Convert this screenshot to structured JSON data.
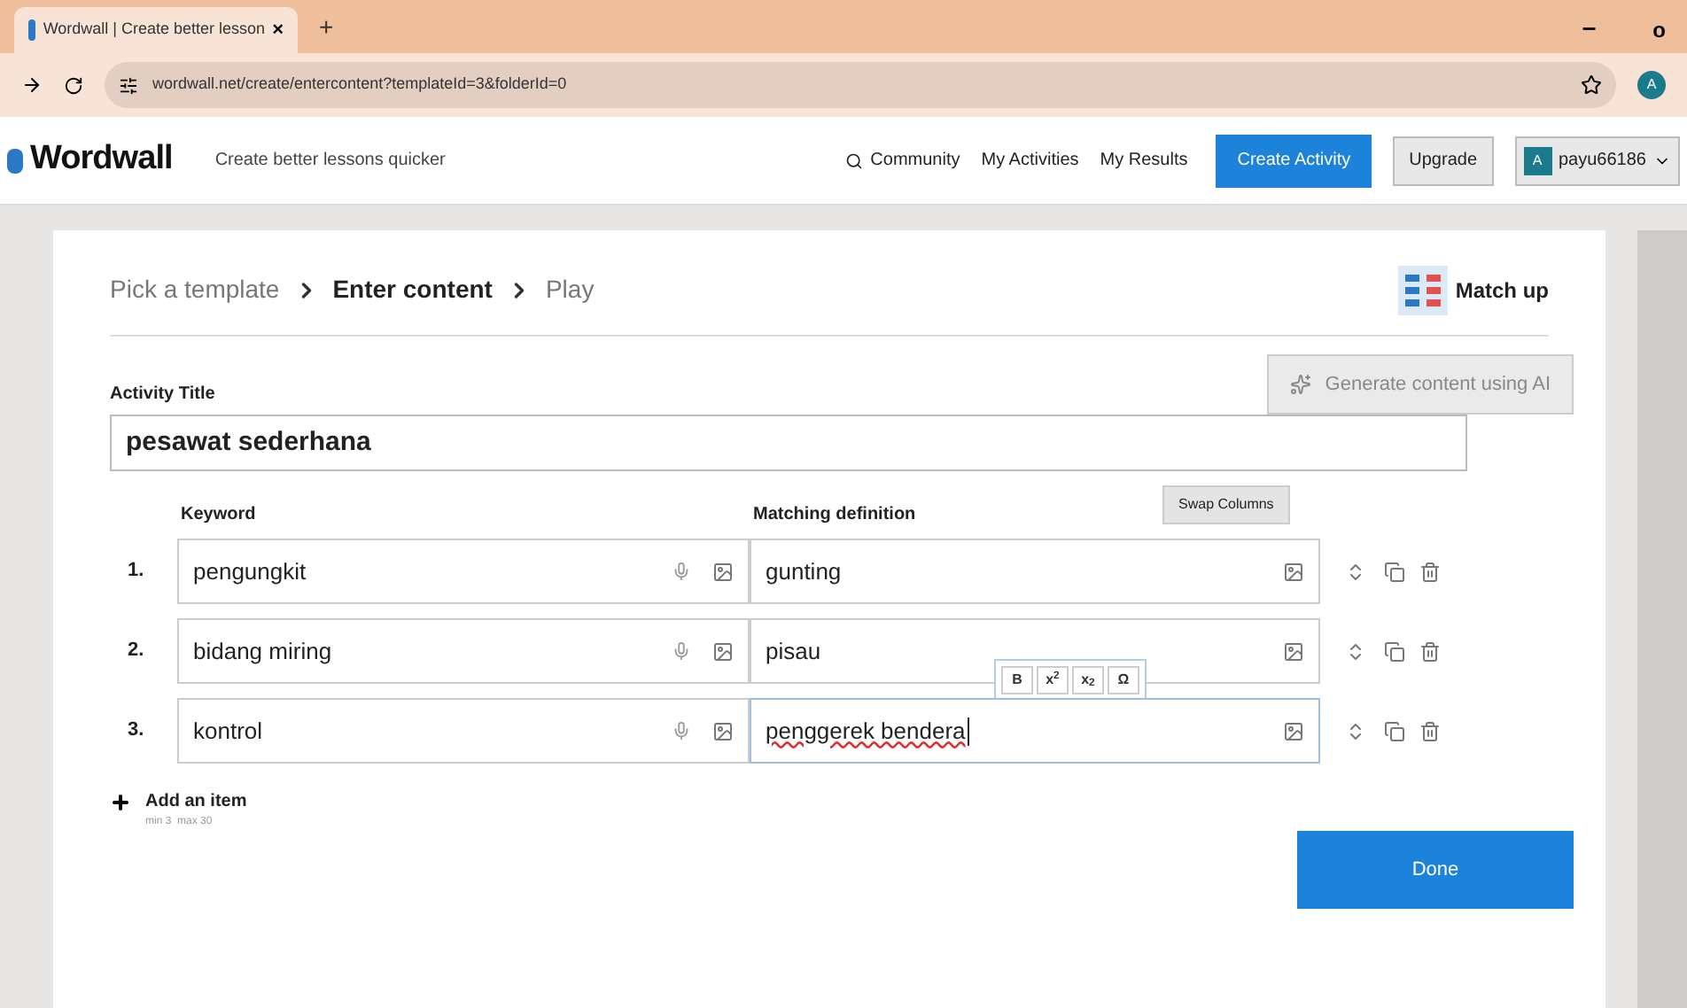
{
  "browser": {
    "tab_title": "Wordwall | Create better lesson",
    "tab_close": "×",
    "new_tab": "+",
    "minimize": "–",
    "restore": "o",
    "url": "wordwall.net/create/entercontent?templateId=3&folderId=0",
    "profile_initial": "A"
  },
  "site": {
    "logo": "Wordwall",
    "tagline": "Create better lessons quicker",
    "nav": [
      "Community",
      "My Activities",
      "My Results"
    ],
    "create_button": "Create Activity",
    "upgrade_button": "Upgrade",
    "user_initial": "A",
    "user_name": "payu66186"
  },
  "breadcrumb": [
    {
      "label": "Pick a template",
      "selected": false
    },
    {
      "label": "Enter content",
      "selected": true
    },
    {
      "label": "Play",
      "selected": false
    }
  ],
  "template": "Match up",
  "activity_title": {
    "label": "Activity Title",
    "value": "pesawat sederhana"
  },
  "ai_button": "Generate content using AI",
  "swap_button": "Swap Columns",
  "columns": [
    "Keyword",
    "Matching definition"
  ],
  "rows": [
    {
      "number": "1.",
      "keyword": "pengungkit",
      "definition": "gunting",
      "focused": false,
      "misspelled": false
    },
    {
      "number": "2.",
      "keyword": "bidang miring",
      "definition": "pisau",
      "focused": false,
      "misspelled": false
    },
    {
      "number": "3.",
      "keyword": "kontrol",
      "definition": "penggerek bendera",
      "focused": true,
      "misspelled": true
    }
  ],
  "format_toolbar": [
    "B",
    "x$^{2}$",
    "x$_{2}$",
    "Ω"
  ],
  "add_item": {
    "label": "Add an item",
    "limits": "min 3  max 30"
  },
  "done_button": "Done"
}
